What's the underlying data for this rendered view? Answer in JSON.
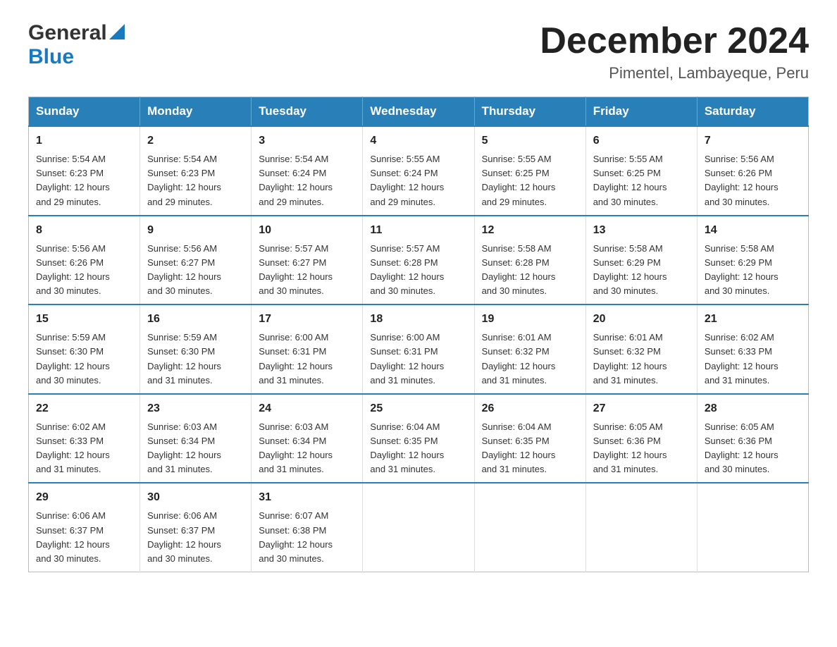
{
  "header": {
    "logo_general": "General",
    "logo_blue": "Blue",
    "month_title": "December 2024",
    "location": "Pimentel, Lambayeque, Peru"
  },
  "weekdays": [
    "Sunday",
    "Monday",
    "Tuesday",
    "Wednesday",
    "Thursday",
    "Friday",
    "Saturday"
  ],
  "weeks": [
    [
      {
        "day": "1",
        "sunrise": "5:54 AM",
        "sunset": "6:23 PM",
        "daylight": "12 hours and 29 minutes."
      },
      {
        "day": "2",
        "sunrise": "5:54 AM",
        "sunset": "6:23 PM",
        "daylight": "12 hours and 29 minutes."
      },
      {
        "day": "3",
        "sunrise": "5:54 AM",
        "sunset": "6:24 PM",
        "daylight": "12 hours and 29 minutes."
      },
      {
        "day": "4",
        "sunrise": "5:55 AM",
        "sunset": "6:24 PM",
        "daylight": "12 hours and 29 minutes."
      },
      {
        "day": "5",
        "sunrise": "5:55 AM",
        "sunset": "6:25 PM",
        "daylight": "12 hours and 29 minutes."
      },
      {
        "day": "6",
        "sunrise": "5:55 AM",
        "sunset": "6:25 PM",
        "daylight": "12 hours and 30 minutes."
      },
      {
        "day": "7",
        "sunrise": "5:56 AM",
        "sunset": "6:26 PM",
        "daylight": "12 hours and 30 minutes."
      }
    ],
    [
      {
        "day": "8",
        "sunrise": "5:56 AM",
        "sunset": "6:26 PM",
        "daylight": "12 hours and 30 minutes."
      },
      {
        "day": "9",
        "sunrise": "5:56 AM",
        "sunset": "6:27 PM",
        "daylight": "12 hours and 30 minutes."
      },
      {
        "day": "10",
        "sunrise": "5:57 AM",
        "sunset": "6:27 PM",
        "daylight": "12 hours and 30 minutes."
      },
      {
        "day": "11",
        "sunrise": "5:57 AM",
        "sunset": "6:28 PM",
        "daylight": "12 hours and 30 minutes."
      },
      {
        "day": "12",
        "sunrise": "5:58 AM",
        "sunset": "6:28 PM",
        "daylight": "12 hours and 30 minutes."
      },
      {
        "day": "13",
        "sunrise": "5:58 AM",
        "sunset": "6:29 PM",
        "daylight": "12 hours and 30 minutes."
      },
      {
        "day": "14",
        "sunrise": "5:58 AM",
        "sunset": "6:29 PM",
        "daylight": "12 hours and 30 minutes."
      }
    ],
    [
      {
        "day": "15",
        "sunrise": "5:59 AM",
        "sunset": "6:30 PM",
        "daylight": "12 hours and 30 minutes."
      },
      {
        "day": "16",
        "sunrise": "5:59 AM",
        "sunset": "6:30 PM",
        "daylight": "12 hours and 31 minutes."
      },
      {
        "day": "17",
        "sunrise": "6:00 AM",
        "sunset": "6:31 PM",
        "daylight": "12 hours and 31 minutes."
      },
      {
        "day": "18",
        "sunrise": "6:00 AM",
        "sunset": "6:31 PM",
        "daylight": "12 hours and 31 minutes."
      },
      {
        "day": "19",
        "sunrise": "6:01 AM",
        "sunset": "6:32 PM",
        "daylight": "12 hours and 31 minutes."
      },
      {
        "day": "20",
        "sunrise": "6:01 AM",
        "sunset": "6:32 PM",
        "daylight": "12 hours and 31 minutes."
      },
      {
        "day": "21",
        "sunrise": "6:02 AM",
        "sunset": "6:33 PM",
        "daylight": "12 hours and 31 minutes."
      }
    ],
    [
      {
        "day": "22",
        "sunrise": "6:02 AM",
        "sunset": "6:33 PM",
        "daylight": "12 hours and 31 minutes."
      },
      {
        "day": "23",
        "sunrise": "6:03 AM",
        "sunset": "6:34 PM",
        "daylight": "12 hours and 31 minutes."
      },
      {
        "day": "24",
        "sunrise": "6:03 AM",
        "sunset": "6:34 PM",
        "daylight": "12 hours and 31 minutes."
      },
      {
        "day": "25",
        "sunrise": "6:04 AM",
        "sunset": "6:35 PM",
        "daylight": "12 hours and 31 minutes."
      },
      {
        "day": "26",
        "sunrise": "6:04 AM",
        "sunset": "6:35 PM",
        "daylight": "12 hours and 31 minutes."
      },
      {
        "day": "27",
        "sunrise": "6:05 AM",
        "sunset": "6:36 PM",
        "daylight": "12 hours and 31 minutes."
      },
      {
        "day": "28",
        "sunrise": "6:05 AM",
        "sunset": "6:36 PM",
        "daylight": "12 hours and 30 minutes."
      }
    ],
    [
      {
        "day": "29",
        "sunrise": "6:06 AM",
        "sunset": "6:37 PM",
        "daylight": "12 hours and 30 minutes."
      },
      {
        "day": "30",
        "sunrise": "6:06 AM",
        "sunset": "6:37 PM",
        "daylight": "12 hours and 30 minutes."
      },
      {
        "day": "31",
        "sunrise": "6:07 AM",
        "sunset": "6:38 PM",
        "daylight": "12 hours and 30 minutes."
      },
      null,
      null,
      null,
      null
    ]
  ],
  "labels": {
    "sunrise": "Sunrise:",
    "sunset": "Sunset:",
    "daylight": "Daylight:"
  }
}
